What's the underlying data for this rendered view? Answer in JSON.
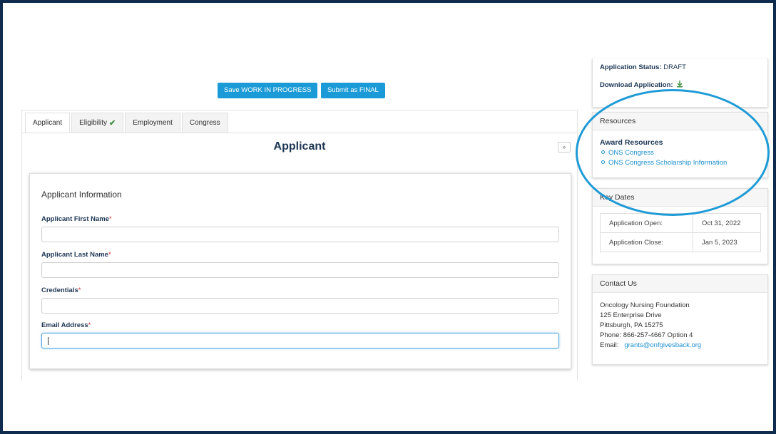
{
  "toolbar": {
    "save_label": "Save WORK IN PROGRESS",
    "submit_label": "Submit as FINAL"
  },
  "tabs": [
    {
      "label": "Applicant",
      "active": true,
      "complete": false
    },
    {
      "label": "Eligibility",
      "active": false,
      "complete": true
    },
    {
      "label": "Employment",
      "active": false,
      "complete": false
    },
    {
      "label": "Congress",
      "active": false,
      "complete": false
    }
  ],
  "main": {
    "section_title": "Applicant",
    "collapse_label": "»",
    "card_title": "Applicant Information",
    "fields": [
      {
        "label": "Applicant First Name",
        "required_mark": "*",
        "value": ""
      },
      {
        "label": "Applicant Last Name",
        "required_mark": "*",
        "value": ""
      },
      {
        "label": "Credentials",
        "required_mark": "*",
        "value": ""
      },
      {
        "label": "Email Address",
        "required_mark": "*",
        "value": ""
      }
    ]
  },
  "status": {
    "status_label": "Application Status:",
    "status_value": "DRAFT",
    "download_label": "Download Application:"
  },
  "resources": {
    "header": "Resources",
    "title": "Award Resources",
    "links": [
      "ONS Congress",
      "ONS Congress Scholarship Information"
    ]
  },
  "key_dates": {
    "header": "Key Dates",
    "rows": [
      {
        "label": "Application Open:",
        "value": "Oct 31, 2022"
      },
      {
        "label": "Application Close:",
        "value": "Jan 5, 2023"
      }
    ]
  },
  "contact": {
    "header": "Contact Us",
    "org": "Oncology Nursing Foundation",
    "address1": "125 Enterprise Drive",
    "address2": "Pittsburgh, PA 15275",
    "phone": "Phone: 866-257-4667 Option 4",
    "email_label": "Email:",
    "email": "grants@onfgivesback.org"
  },
  "colors": {
    "accent": "#1a9bd7",
    "highlight_circle": "#1e9ad6",
    "frame_border": "#0f2c4f"
  }
}
